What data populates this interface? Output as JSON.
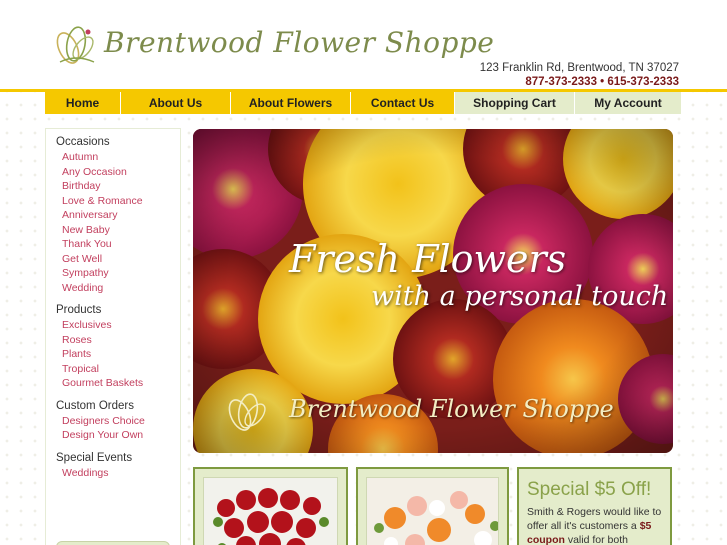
{
  "brand": {
    "name": "Brentwood Flower Shoppe",
    "address": "123 Franklin Rd, Brentwood, TN 37027",
    "phones": "877-373-2333 • 615-373-2333"
  },
  "nav": [
    {
      "label": "Home",
      "style": "yellow"
    },
    {
      "label": "About Us",
      "style": "yellow"
    },
    {
      "label": "About Flowers",
      "style": "yellow"
    },
    {
      "label": "Contact Us",
      "style": "yellow"
    },
    {
      "label": "Shopping Cart",
      "style": "green"
    },
    {
      "label": "My Account",
      "style": "green"
    }
  ],
  "sidebar": {
    "occasions": {
      "heading": "Occasions",
      "items": [
        "Autumn",
        "Any Occasion",
        "Birthday",
        "Love & Romance",
        "Anniversary",
        "New Baby",
        "Thank You",
        "Get Well",
        "Sympathy",
        "Wedding"
      ]
    },
    "products": {
      "heading": "Products",
      "items": [
        "Exclusives",
        "Roses",
        "Plants",
        "Tropical",
        "Gourmet Baskets"
      ]
    },
    "custom": {
      "heading": "Custom Orders",
      "items": [
        "Designers Choice",
        "Design Your Own"
      ]
    },
    "events": {
      "heading": "Special Events",
      "items": [
        "Weddings"
      ]
    }
  },
  "hero": {
    "line1": "Fresh Flowers",
    "line2": "with a personal touch",
    "logo_text": "Brentwood Flower Shoppe"
  },
  "promo": {
    "title": "Special $5 Off!",
    "body_1": "Smith & Rogers would like to offer all it's customers a",
    "body_bold_1": "$5",
    "body_bold_2": "coupon",
    "body_2": "valid for both internet"
  },
  "colors": {
    "nav_yellow": "#f5c800",
    "nav_green": "#e4eccb",
    "link_pink": "#c23f5e",
    "card_border": "#7e9a3f",
    "logo_olive": "#7d8b4c"
  }
}
